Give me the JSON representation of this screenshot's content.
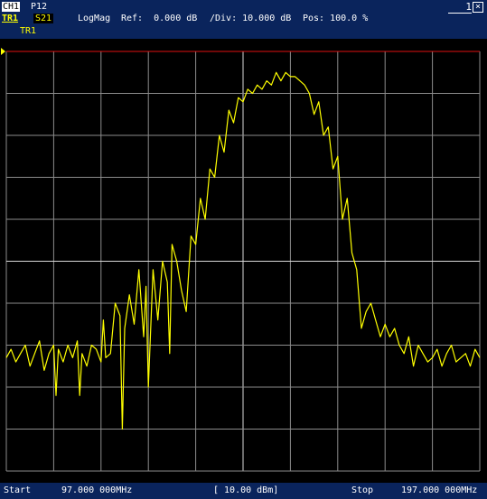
{
  "header": {
    "channel": "CH1",
    "port": "P12",
    "trace": "TR1",
    "sparam": "S21",
    "format": "LogMag",
    "ref": "Ref:  0.000 dB",
    "div": "/Div: 10.000 dB",
    "pos": "Pos: 100.0 %",
    "trace_label": "TR1",
    "window_number": "1",
    "close_symbol": "×"
  },
  "footer": {
    "start_label": "Start",
    "start_value": "97.000 000MHz",
    "scale": "[ 10.00 dBm]",
    "stop_label": "Stop",
    "stop_value": "197.000 000MHz"
  },
  "colors": {
    "background": "#000000",
    "header_bg": "#0a245c",
    "grid": "#8c8c8c",
    "trace": "#ffff00",
    "ref_line": "#e01010"
  },
  "chart_data": {
    "type": "line",
    "xlim": [
      97,
      197
    ],
    "ylim": [
      -100,
      0
    ],
    "grid": true,
    "divisions": {
      "x": 10,
      "y": 10
    },
    "series": [
      {
        "x": [
          97,
          98,
          99,
          100,
          101,
          102,
          103,
          104,
          105,
          106,
          107,
          107.5,
          108,
          109,
          110,
          111,
          112,
          112.5,
          113,
          114,
          115,
          116,
          117,
          117.5,
          118,
          119,
          120,
          121,
          121.5,
          122,
          123,
          124,
          125,
          126,
          126.5,
          127,
          128,
          129,
          130,
          131,
          131.5,
          132,
          133,
          134,
          135,
          136,
          137,
          138,
          139,
          140,
          141,
          142,
          143,
          144,
          145,
          146,
          147,
          148,
          149,
          150,
          151,
          152,
          153,
          154,
          155,
          156,
          157,
          158,
          159,
          160,
          161,
          162,
          163,
          164,
          165,
          166,
          167,
          168,
          169,
          170,
          171,
          172,
          173,
          174,
          175,
          176,
          177,
          178,
          179,
          180,
          181,
          182,
          183,
          184,
          185,
          186,
          187,
          188,
          189,
          190,
          191,
          192,
          193,
          194,
          195,
          196,
          197
        ],
        "values": [
          -73,
          -71,
          -74,
          -72,
          -70,
          -75,
          -72,
          -69,
          -76,
          -72,
          -70,
          -82,
          -71,
          -74,
          -70,
          -73,
          -69,
          -82,
          -72,
          -75,
          -70,
          -71,
          -74,
          -64,
          -73,
          -72,
          -60,
          -63,
          -90,
          -66,
          -58,
          -65,
          -52,
          -68,
          -56,
          -80,
          -52,
          -64,
          -50,
          -55,
          -72,
          -46,
          -50,
          -57,
          -62,
          -44,
          -46,
          -35,
          -40,
          -28,
          -30,
          -20,
          -24,
          -14,
          -17,
          -11,
          -12,
          -9,
          -10,
          -8,
          -9,
          -7,
          -8,
          -5,
          -7,
          -5,
          -6,
          -6,
          -7,
          -8,
          -10,
          -15,
          -12,
          -20,
          -18,
          -28,
          -25,
          -40,
          -35,
          -48,
          -52,
          -66,
          -62,
          -60,
          -64,
          -68,
          -65,
          -68,
          -66,
          -70,
          -72,
          -68,
          -75,
          -70,
          -72,
          -74,
          -73,
          -71,
          -75,
          -72,
          -70,
          -74,
          -73,
          -72,
          -75,
          -71,
          -73
        ]
      }
    ]
  }
}
